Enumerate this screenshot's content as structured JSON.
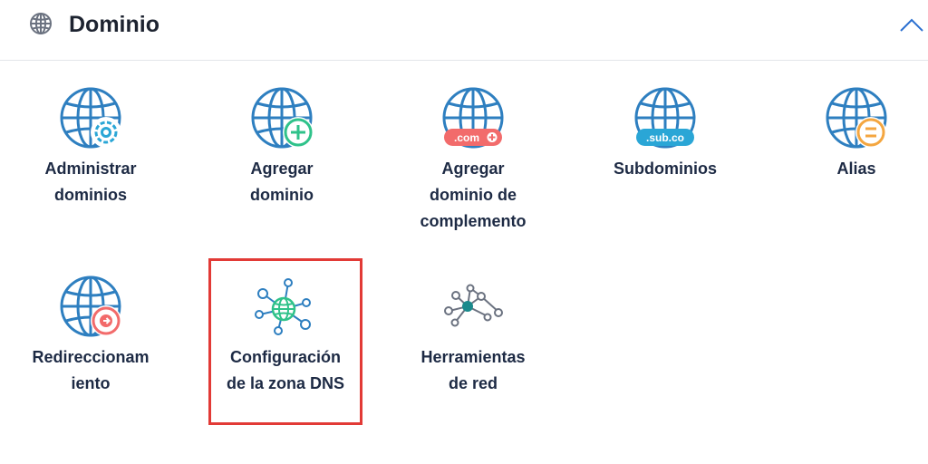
{
  "header": {
    "title": "Dominio",
    "icon": "globe-icon",
    "collapse_icon": "chevron-up-icon"
  },
  "tiles": [
    {
      "label": "Administrar\ndominios",
      "icon": "globe-gear-icon"
    },
    {
      "label": "Agregar\ndominio",
      "icon": "globe-plus-icon"
    },
    {
      "label": "Agregar\ndominio de\ncomplemento",
      "icon": "globe-dotcom-icon",
      "badge": ".com"
    },
    {
      "label": "Subdominios",
      "icon": "globe-subdomain-icon",
      "badge": ".sub.co"
    },
    {
      "label": "Alias",
      "icon": "globe-equals-icon"
    },
    {
      "label": "Redireccionam\niento",
      "icon": "globe-redirect-icon"
    },
    {
      "label": "Configuración\nde la zona DNS",
      "icon": "dns-zone-network-icon"
    },
    {
      "label": "Herramientas\nde red",
      "icon": "network-tools-icon"
    }
  ],
  "colors": {
    "globe_blue": "#2e7fc0",
    "accent_green": "#2fc28a",
    "accent_coral": "#f26b6b",
    "accent_teal": "#2aa6d6",
    "accent_orange": "#f4a640",
    "highlight_red": "#e23a36",
    "label": "#1d2a44",
    "chevron": "#2a6fd0"
  }
}
